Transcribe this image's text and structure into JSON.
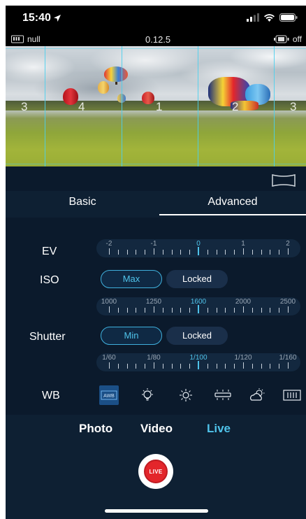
{
  "status_bar": {
    "time": "15:40"
  },
  "info_bar": {
    "left_label": "null",
    "version": "0.12.5",
    "right_label": "off"
  },
  "preview": {
    "grid_numbers": [
      "3",
      "4",
      "1",
      "2",
      "3"
    ]
  },
  "tabs": [
    {
      "label": "Basic"
    },
    {
      "label": "Advanced"
    }
  ],
  "active_tab": "Advanced",
  "settings": {
    "ev": {
      "label": "EV",
      "ticks": [
        "-2",
        "-1",
        "0",
        "1",
        "2"
      ],
      "selected": "0"
    },
    "iso": {
      "label": "ISO",
      "mode_options": [
        "Max",
        "Locked"
      ],
      "active_mode": "Max",
      "ticks": [
        "1000",
        "1250",
        "1600",
        "2000",
        "2500"
      ],
      "selected": "1600"
    },
    "shutter": {
      "label": "Shutter",
      "mode_options": [
        "Min",
        "Locked"
      ],
      "active_mode": "Min",
      "ticks": [
        "1/60",
        "1/80",
        "1/100",
        "1/120",
        "1/160"
      ],
      "selected": "1/100"
    },
    "wb": {
      "label": "WB",
      "options": [
        "awb-icon",
        "incandescent-icon",
        "daylight-icon",
        "fluorescent-icon",
        "cloudy-icon",
        "manual-wb-icon"
      ],
      "selected": "awb-icon",
      "awb_text": "AWB"
    }
  },
  "capture_modes": [
    "Photo",
    "Video",
    "Live"
  ],
  "active_mode": "Live",
  "shutter_button": {
    "label": "LIVE"
  },
  "colors": {
    "accent": "#4fc3ea",
    "record": "#e3262b",
    "background": "#0b1a2c",
    "panel": "#0e2033"
  }
}
